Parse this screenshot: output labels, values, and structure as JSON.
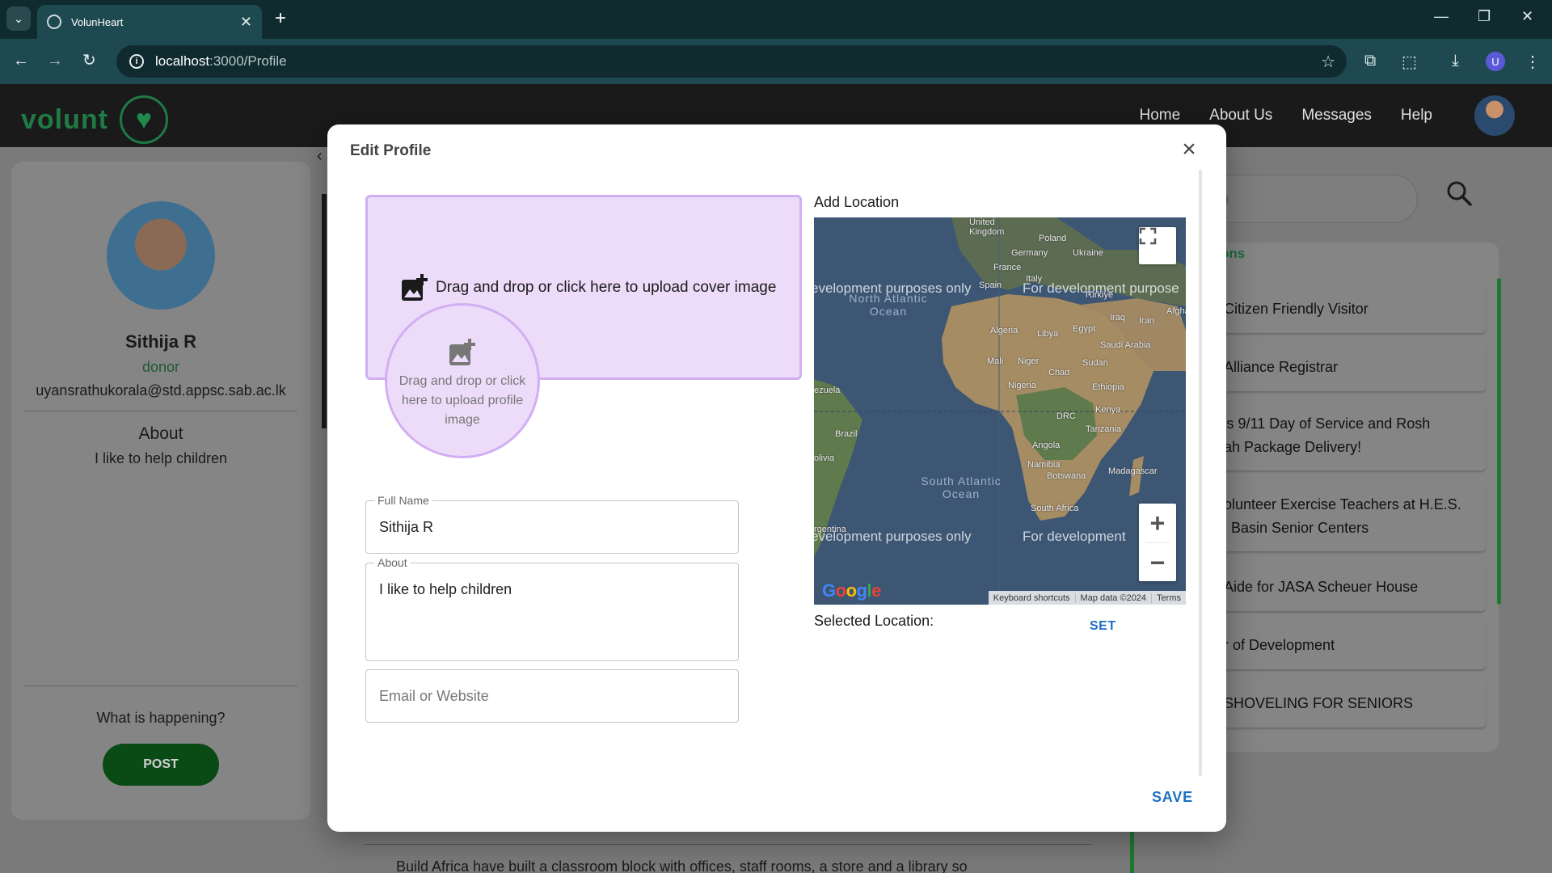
{
  "browser": {
    "tab_title": "VolunHeart",
    "url_host": "localhost",
    "url_path": ":3000/Profile",
    "profile_initial": "U"
  },
  "header": {
    "logo_text": "volunt",
    "nav": [
      "Home",
      "About Us",
      "Messages",
      "Help"
    ]
  },
  "background": {
    "profile_name": "Sithija R",
    "profile_role": "donor",
    "profile_email": "uyansrathukorala@std.appsc.sab.ac.lk",
    "about_heading": "About",
    "about_text": "I like to help children",
    "what_happening": "What is happening?",
    "post_label": "POST",
    "search_fragment": "h",
    "right_heading_fragment": "ons",
    "items": [
      {
        "line1": "Citizen Friendly Visitor",
        "line2": ""
      },
      {
        "line1": "Alliance Registrar",
        "line2": ""
      },
      {
        "line1": "'s 9/11 Day of Service and Rosh",
        "line2": "ah Package Delivery!"
      },
      {
        "line1": "olunteer Exercise Teachers at H.E.S.",
        "line2": "l Basin Senior Centers"
      },
      {
        "line1": "Aide for JASA Scheuer House",
        "line2": ""
      },
      {
        "line1": "r of Development",
        "line2": ""
      },
      {
        "line1": "SHOVELING FOR SENIORS",
        "line2": ""
      }
    ],
    "bottom_text": "Build Africa have built a classroom block with offices, staff rooms, a store and a library so"
  },
  "modal": {
    "title": "Edit Profile",
    "cover_upload_text": "Drag and drop or click here to upload cover image",
    "profile_upload_text": "Drag and drop or click here to upload profile image",
    "full_name_label": "Full Name",
    "full_name_value": "Sithija R",
    "about_label": "About",
    "about_value": "I like to help children",
    "email_placeholder": "Email or Website",
    "add_location_label": "Add Location",
    "selected_location_label": "Selected Location:",
    "set_label": "SET",
    "save_label": "SAVE"
  },
  "map": {
    "watermark": "For development purposes only",
    "watermark_left": "evelopment purposes only",
    "watermark_right": "For development purpose",
    "watermark_bottom_right": "For development",
    "countries": [
      "United Kingdom",
      "Poland",
      "Germany",
      "Ukraine",
      "France",
      "Spain",
      "Italy",
      "Türkiye",
      "Algeria",
      "Libya",
      "Egypt",
      "Iraq",
      "Iran",
      "Afgha",
      "Saudi Arabia",
      "Mali",
      "Niger",
      "Chad",
      "Sudan",
      "Nigeria",
      "Ethiopia",
      "Kenya",
      "DRC",
      "Tanzania",
      "Angola",
      "Namibia",
      "Botswana",
      "Madagascar",
      "South Africa",
      "Brazil",
      "ezuela",
      "olivia",
      "rgentina"
    ],
    "oceans": [
      "North Atlantic Ocean",
      "South Atlantic Ocean"
    ],
    "footer": [
      "Keyboard shortcuts",
      "Map data ©2024",
      "Terms"
    ],
    "logo": "Google"
  },
  "colors": {
    "accent_blue": "#1d6fc4",
    "upload_bg": "#ecdcf9",
    "upload_border": "#d2aef2",
    "brand_green": "#1f7a45"
  }
}
